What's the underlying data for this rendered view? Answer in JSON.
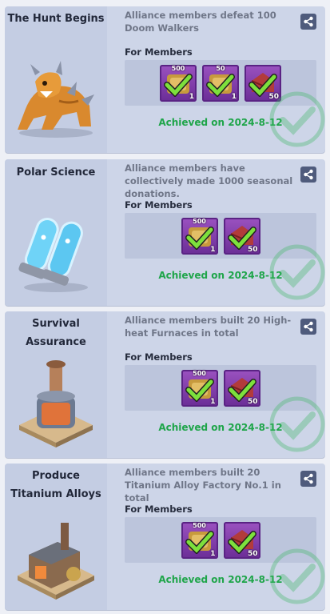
{
  "section_label": "For Members",
  "cards": [
    {
      "title": "The Hunt Begins",
      "description": "Alliance members defeat 100 Doom Walkers",
      "achieved": "Achieved on 2024-8-12",
      "rewards": [
        {
          "icon": "speedup-icon",
          "top": "500",
          "qty": "1"
        },
        {
          "icon": "speedup-icon",
          "top": "50",
          "qty": "1"
        },
        {
          "icon": "gem-chest-icon",
          "top": "",
          "qty": "50"
        }
      ]
    },
    {
      "title": "Polar Science",
      "description": "Alliance members have collectively made 1000 seasonal donations.",
      "achieved": "Achieved on 2024-8-12",
      "rewards": [
        {
          "icon": "speedup-icon",
          "top": "500",
          "qty": "1"
        },
        {
          "icon": "gem-chest-icon",
          "top": "",
          "qty": "50"
        }
      ]
    },
    {
      "title": "Survival Assurance",
      "description": "Alliance members built 20 High-heat Furnaces in total",
      "achieved": "Achieved on 2024-8-12",
      "rewards": [
        {
          "icon": "speedup-icon",
          "top": "500",
          "qty": "1"
        },
        {
          "icon": "gem-chest-icon",
          "top": "",
          "qty": "50"
        }
      ]
    },
    {
      "title": "Produce Titanium Alloys",
      "description": "Alliance members built 20 Titanium Alloy Factory No.1 in total",
      "achieved": "Achieved on 2024-8-12",
      "rewards": [
        {
          "icon": "speedup-icon",
          "top": "500",
          "qty": "1"
        },
        {
          "icon": "gem-chest-icon",
          "top": "",
          "qty": "50"
        }
      ]
    }
  ],
  "colors": {
    "card_bg": "#cdd5e8",
    "achieved_green": "#1fa54a",
    "item_purple": "#7a3aa8"
  }
}
